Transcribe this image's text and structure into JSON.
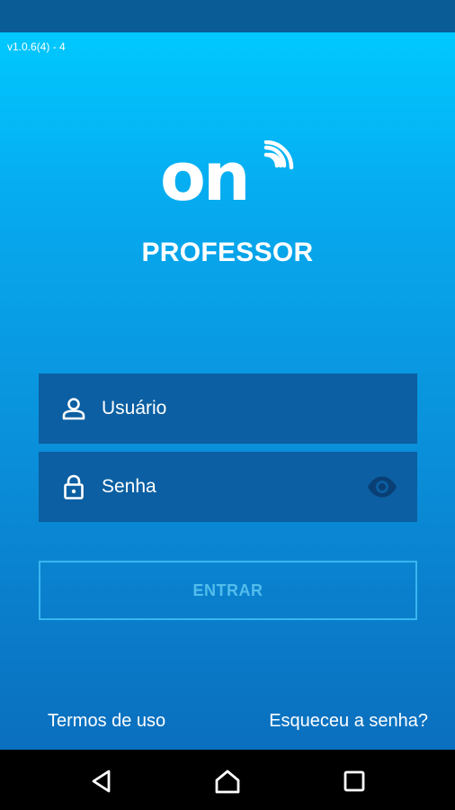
{
  "app": {
    "version": "v1.0.6(4) - 4",
    "logo_text": "on",
    "subtitle": "PROFESSOR"
  },
  "login": {
    "username_placeholder": "Usuário",
    "password_placeholder": "Senha",
    "submit_label": "ENTRAR"
  },
  "links": {
    "terms": "Termos de uso",
    "forgot_password": "Esqueceu a senha?"
  },
  "icons": {
    "logo_signal": "wifi-icon",
    "username": "user-icon",
    "password": "lock-icon",
    "show_password": "eye-icon",
    "nav_back": "back-icon",
    "nav_home": "home-icon",
    "nav_recent": "recent-apps-icon"
  },
  "colors": {
    "gradient_top": "#00c8ff",
    "gradient_bottom": "#0a6fbe",
    "field_background": "#0b5fa2",
    "button_border": "#39b6f0",
    "button_text": "#52bdec",
    "eye_icon": "#0a3f75"
  }
}
